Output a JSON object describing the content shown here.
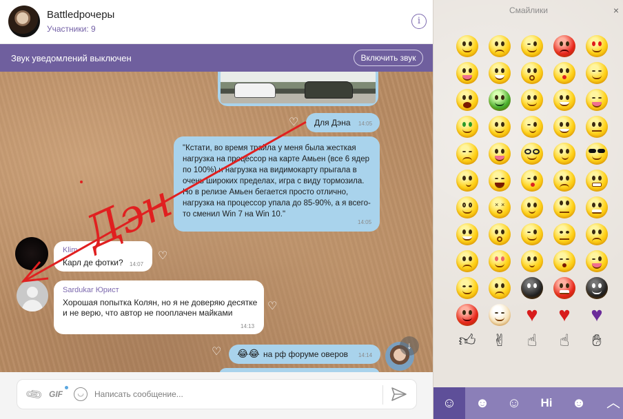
{
  "header": {
    "title": "Battledрочеры",
    "subtitle": "Участники: 9",
    "info_icon": "info-icon"
  },
  "notification": {
    "text": "Звук уведомлений выключен",
    "button": "Включить звук"
  },
  "messages": {
    "dlya": {
      "text": "Для Дэна",
      "time": "14:05"
    },
    "long": {
      "text": "\"Кстати, во время трайла у меня была жесткая нагрузка на процессор на карте Амьен (все 6 ядер по 100%) и нагрузка на видимокарту прыгала в очень широких пределах, игра с виду тормозила. Но в релизе Амьен бегается просто отлично, нагрузка на процессор упала до 85-90%, а я всего-то сменил Win 7 на Win 10.\"",
      "time": "14:05"
    },
    "klim": {
      "sender": "Klim",
      "text": "Карл де фотки?",
      "time": "14:07"
    },
    "sardukar": {
      "sender": "Sardukar Юрист",
      "text": "Хорошая попытка Колян, но я не доверяю десятке и не верю, что автор не пооплачен майками",
      "time": "14:13"
    },
    "rf": {
      "emoji": "😂😂",
      "text": "на рф форуме оверов",
      "time": "14:14"
    }
  },
  "annotation": {
    "text": "Дэн",
    "color": "#e02020"
  },
  "composer": {
    "gif_label": "GIF",
    "placeholder": "Написать сообщение..."
  },
  "panel": {
    "title": "Смайлики",
    "close": "×",
    "tabs": [
      "smiley-tab",
      "cat-tab",
      "monster-tab",
      "hi-tab",
      "character-tab"
    ],
    "hi_label": "Hi"
  },
  "colors": {
    "accent": "#6f5f9e",
    "outgoing_bubble": "#a9d3ec",
    "panel_tabs": "#8b7fb8"
  }
}
